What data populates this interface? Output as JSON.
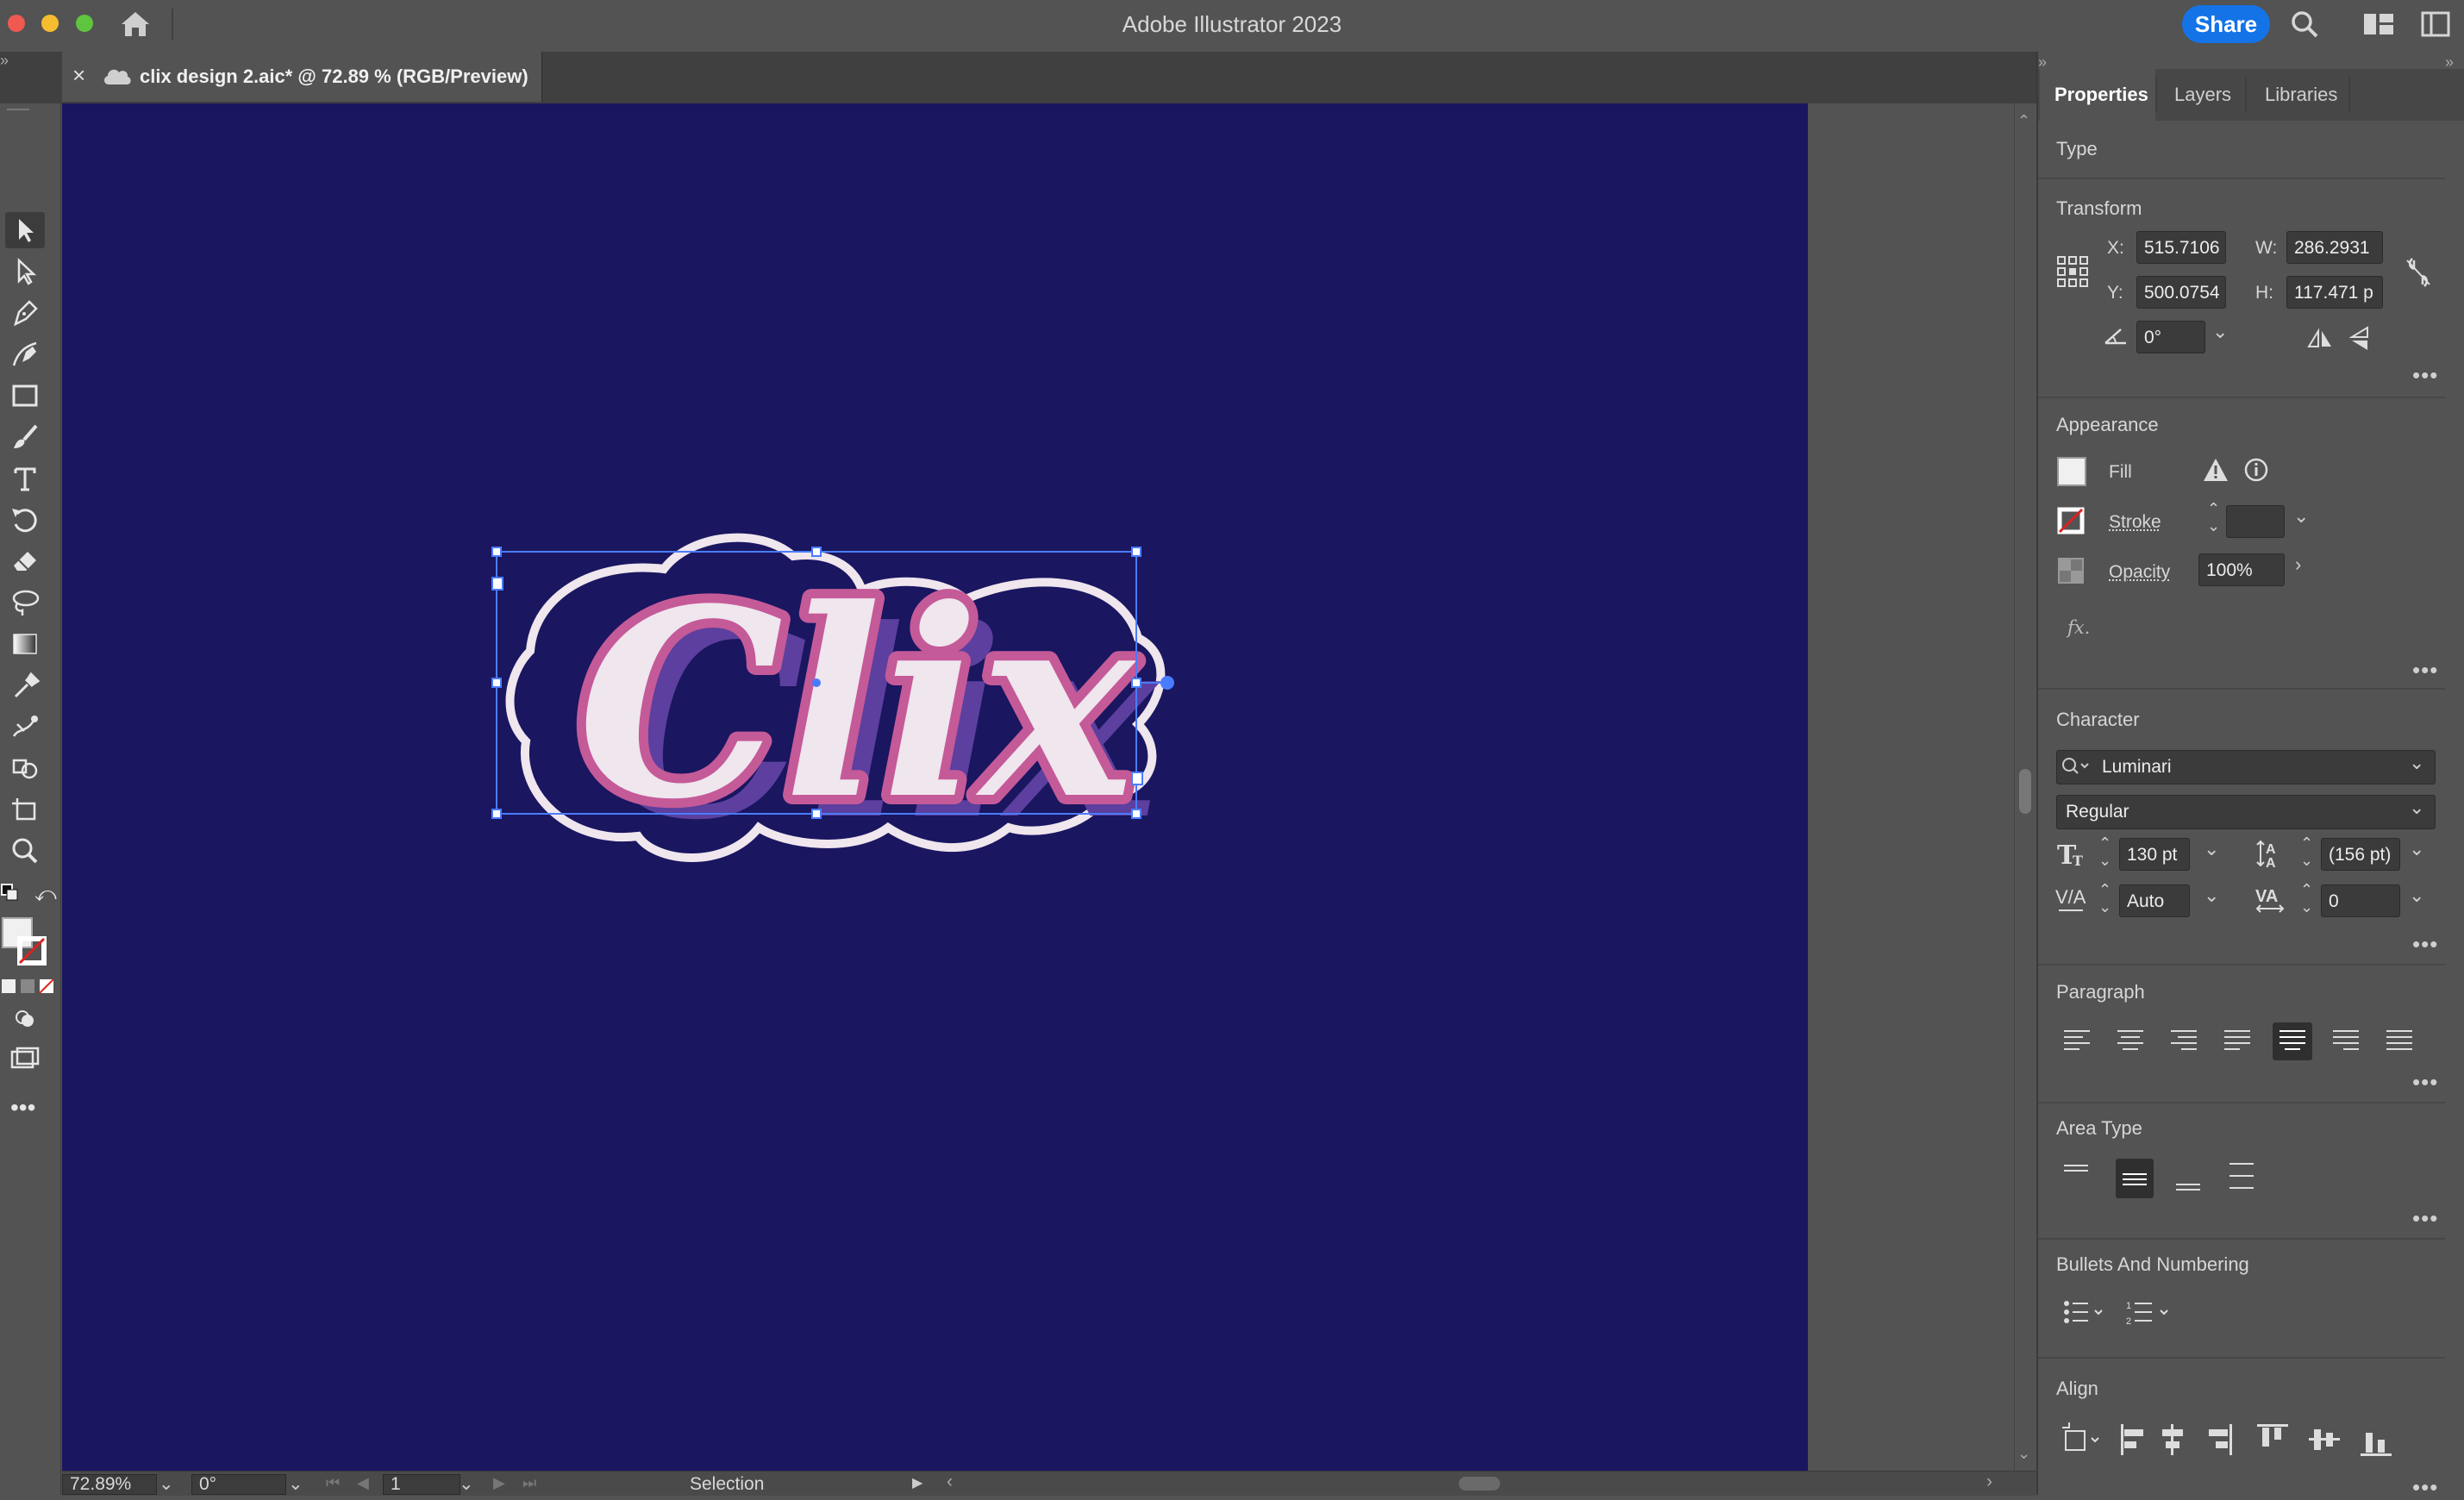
{
  "app": {
    "title": "Adobe Illustrator 2023",
    "share_label": "Share"
  },
  "document": {
    "tab_title": "clix design 2.aic* @ 72.89 % (RGB/Preview)",
    "close_glyph": "×"
  },
  "canvas": {
    "artwork_text": "Clix",
    "colors": {
      "artboard": "#1a1660",
      "letter_fill": "#efe6ee",
      "shadow_pink": "#c55a98",
      "shadow_purple": "#5c3f9e",
      "outline": "#efe6ee",
      "selection": "#4a7cff"
    }
  },
  "status": {
    "zoom": "72.89%",
    "rotation": "0°",
    "artboard_number": "1",
    "tool": "Selection"
  },
  "panel": {
    "tabs": [
      "Properties",
      "Layers",
      "Libraries"
    ],
    "active_tab": "Properties",
    "object_type": "Type",
    "transform": {
      "title": "Transform",
      "x_label": "X:",
      "x": "515.7106",
      "y_label": "Y:",
      "y": "500.0754",
      "w_label": "W:",
      "w": "286.2931",
      "h_label": "H:",
      "h": "117.471 p",
      "rotate": "0°"
    },
    "appearance": {
      "title": "Appearance",
      "fill_label": "Fill",
      "stroke_label": "Stroke",
      "opacity_label": "Opacity",
      "opacity": "100%",
      "fx": "fx."
    },
    "character": {
      "title": "Character",
      "font": "Luminari",
      "style": "Regular",
      "size": "130 pt",
      "leading": "(156 pt)",
      "kerning": "Auto",
      "tracking": "0"
    },
    "paragraph": {
      "title": "Paragraph"
    },
    "area_type": {
      "title": "Area Type"
    },
    "bullets": {
      "title": "Bullets And Numbering"
    },
    "align": {
      "title": "Align"
    }
  }
}
